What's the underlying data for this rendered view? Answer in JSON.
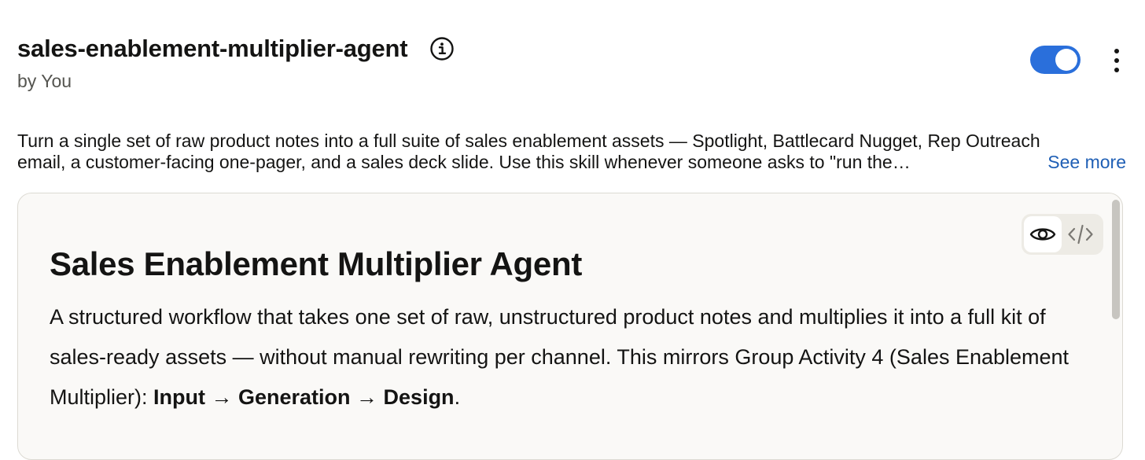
{
  "header": {
    "title": "sales-enablement-multiplier-agent",
    "author": "by You",
    "toggle_on": true
  },
  "description": {
    "line1": "Turn a single set of raw product notes into a full suite of sales enablement assets — Spotlight, Battlecard Nugget, Rep Outreach",
    "line2": "email, a customer-facing one-pager, and a sales deck slide. Use this skill whenever someone asks to \"run the…",
    "see_more": "See more"
  },
  "preview": {
    "view_modes": [
      "eye-icon",
      "code-icon"
    ],
    "active_view": "eye-icon",
    "title": "Sales Enablement Multiplier Agent",
    "paragraph_text": "A structured workflow that takes one set of raw, unstructured product notes and multiplies it into a full kit of sales-ready assets — without manual rewriting per channel. This mirrors Group Activity 4 (Sales Enablement Multiplier): ",
    "paragraph_bold": "Input → Generation → Design",
    "paragraph_end": "."
  },
  "colors": {
    "accent": "#2a6fdb",
    "link": "#1f5fb5",
    "card_bg": "#faf9f7",
    "card_border": "#dcdad3"
  }
}
